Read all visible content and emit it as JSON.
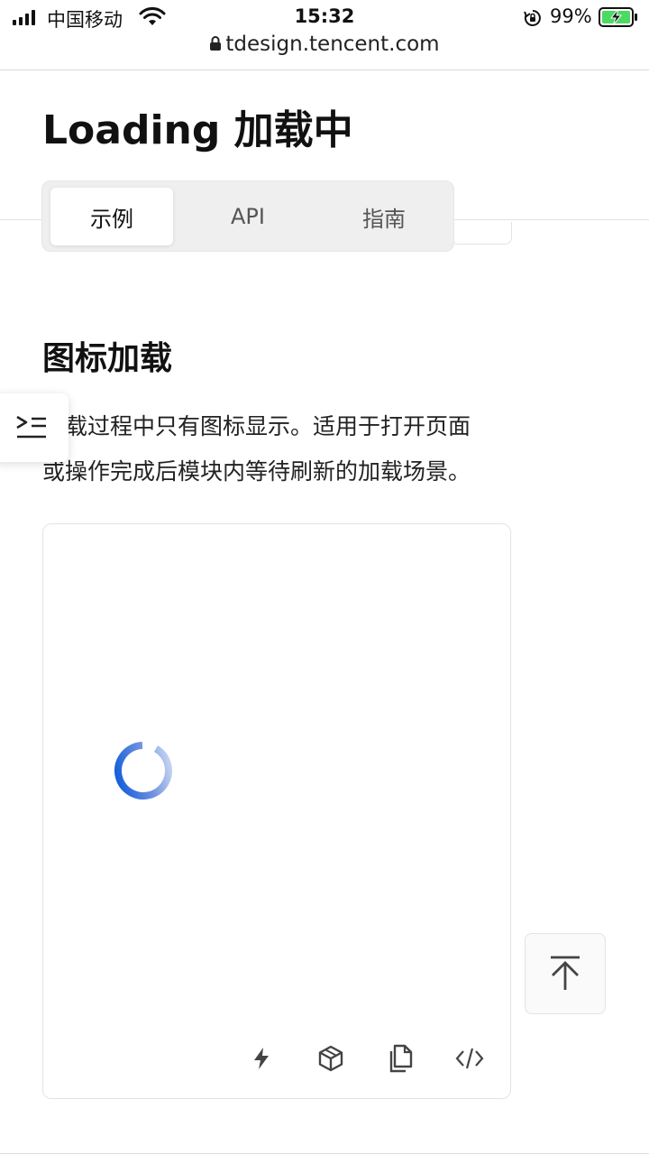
{
  "status_bar": {
    "carrier": "中国移动",
    "time": "15:32",
    "battery_pct": "99%"
  },
  "browser": {
    "url": "tdesign.tencent.com"
  },
  "page": {
    "title": "Loading 加载中"
  },
  "tabs": [
    {
      "label": "示例",
      "active": true
    },
    {
      "label": "API",
      "active": false
    },
    {
      "label": "指南",
      "active": false
    }
  ],
  "section": {
    "title": "图标加载",
    "description": "加载过程中只有图标显示。适用于打开页面\n或操作完成后模块内等待刷新的加载场景。"
  },
  "demo_toolbar": {
    "icons": [
      "lightning-icon",
      "cube-icon",
      "copy-icon",
      "code-icon"
    ]
  },
  "colors": {
    "accent": "#0052d9",
    "tab_bg": "#efefef"
  }
}
